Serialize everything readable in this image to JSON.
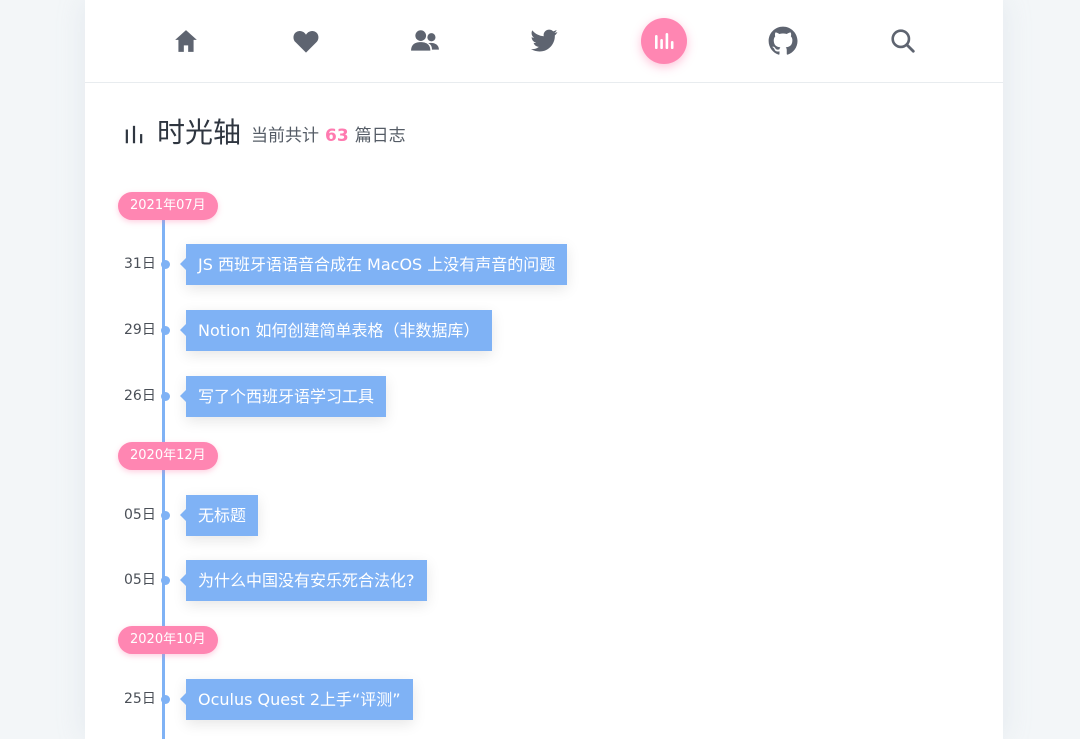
{
  "nav": {
    "items": [
      {
        "icon": "home-icon"
      },
      {
        "icon": "heart-icon"
      },
      {
        "icon": "users-icon"
      },
      {
        "icon": "twitter-icon"
      },
      {
        "icon": "timeline-icon",
        "active": true
      },
      {
        "icon": "github-icon"
      },
      {
        "icon": "search-icon"
      }
    ]
  },
  "header": {
    "title": "时光轴",
    "subtitle_prefix": "当前共计",
    "count": "63",
    "subtitle_suffix": "篇日志"
  },
  "timeline": {
    "groups": [
      {
        "month": "2021年07月",
        "entries": [
          {
            "day": "31日",
            "title": "JS 西班牙语语音合成在 MacOS 上没有声音的问题"
          },
          {
            "day": "29日",
            "title": "Notion 如何创建简单表格（非数据库）"
          },
          {
            "day": "26日",
            "title": "写了个西班牙语学习工具"
          }
        ]
      },
      {
        "month": "2020年12月",
        "entries": [
          {
            "day": "05日",
            "title": "无标题"
          },
          {
            "day": "05日",
            "title": "为什么中国没有安乐死合法化?"
          }
        ]
      },
      {
        "month": "2020年10月",
        "entries": [
          {
            "day": "25日",
            "title": "Oculus Quest 2上手“评测”"
          }
        ]
      }
    ]
  },
  "colors": {
    "accent_pink": "#ff86b2",
    "accent_blue": "#7fb2f5",
    "icon_gray": "#5e6470"
  }
}
